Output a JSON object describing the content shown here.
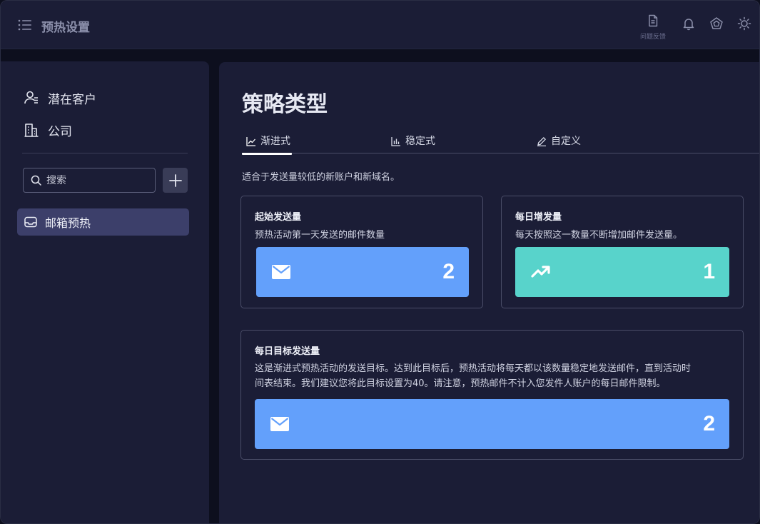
{
  "header": {
    "title": "预热设置",
    "feedback_label": "问题反馈"
  },
  "sidebar": {
    "items": [
      {
        "label": "潜在客户",
        "icon": "leads-icon"
      },
      {
        "label": "公司",
        "icon": "building-icon"
      }
    ],
    "search_placeholder": "搜索",
    "active_item": {
      "label": "邮箱预热",
      "icon": "inbox-icon"
    }
  },
  "main": {
    "title": "策略类型",
    "tabs": [
      {
        "label": "渐进式",
        "icon": "line-chart-icon",
        "active": true
      },
      {
        "label": "稳定式",
        "icon": "bar-chart-icon",
        "active": false
      },
      {
        "label": "自定义",
        "icon": "pencil-icon",
        "active": false
      }
    ],
    "tab_description": "适合于发送量较低的新账户和新域名。",
    "cards": {
      "start_volume": {
        "title": "起始发送量",
        "description": "预热活动第一天发送的邮件数量",
        "value": "2",
        "color": "#63a0fb"
      },
      "daily_increase": {
        "title": "每日增发量",
        "description": "每天按照这一数量不断增加邮件发送量。",
        "value": "1",
        "color": "#58d3cb"
      },
      "daily_target": {
        "title": "每日目标发送量",
        "description_line1": "这是渐进式预热活动的发送目标。达到此目标后，预热活动将每天都以该数量稳定地发送邮件，直到活动时",
        "description_line2": "间表结束。我们建议您将此目标设置为40。请注意，预热邮件不计入您发件人账户的每日邮件限制。",
        "value": "2",
        "color": "#63a0fb"
      }
    }
  }
}
